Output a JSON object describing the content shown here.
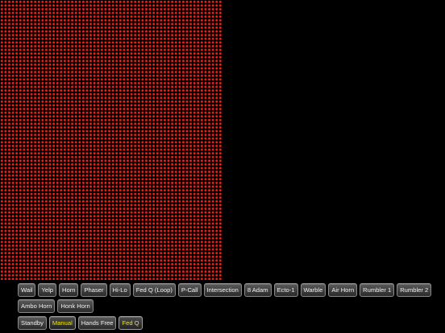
{
  "led_display": {
    "color": "#ff2a1f",
    "state": "all-on"
  },
  "tones": [
    {
      "label": "Wail",
      "active": false
    },
    {
      "label": "Yelp",
      "active": false
    },
    {
      "label": "Horn",
      "active": false
    },
    {
      "label": "Phaser",
      "active": false
    },
    {
      "label": "Hi-Lo",
      "active": false
    },
    {
      "label": "Fed Q (Loop)",
      "active": false
    },
    {
      "label": "P-Call",
      "active": false
    },
    {
      "label": "Intersection",
      "active": false
    },
    {
      "label": "8 Adam",
      "active": false
    },
    {
      "label": "Ecto-1",
      "active": false
    },
    {
      "label": "Warble",
      "active": false
    },
    {
      "label": "Air Horn",
      "active": false
    },
    {
      "label": "Rumbler 1",
      "active": false
    },
    {
      "label": "Rumbler 2",
      "active": false
    },
    {
      "label": "Ambo Horn",
      "active": false
    },
    {
      "label": "Honk Horn",
      "active": false
    }
  ],
  "modes": [
    {
      "label": "Standby",
      "active": false
    },
    {
      "label": "Manual",
      "active": true
    },
    {
      "label": "Hands Free",
      "active": false
    },
    {
      "label": "Fed Q",
      "active": true
    }
  ],
  "colors": {
    "active_text": "#f2e600",
    "inactive_text": "#f2f2f2"
  }
}
